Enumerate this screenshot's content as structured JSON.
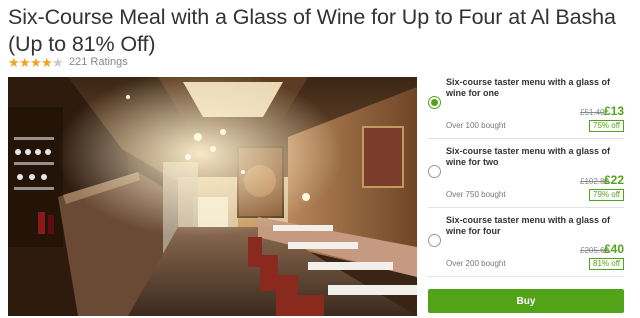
{
  "deal": {
    "title": "Six-Course Meal with a Glass of Wine for Up to Four at Al Basha (Up to 81% Off)",
    "rating_stars": 4,
    "rating_max": 5,
    "ratings_count": "221 Ratings"
  },
  "image": {
    "alt_icon": "restaurant-interior-photo"
  },
  "options": [
    {
      "title": "Six-course taster menu with a glass of wine for one",
      "original_price": "£51.40",
      "price": "£13",
      "bought": "Over 100 bought",
      "discount": "75% off",
      "selected": true
    },
    {
      "title": "Six-course taster menu with a glass of wine for two",
      "original_price": "£102.80",
      "price": "£22",
      "bought": "Over 750 bought",
      "discount": "79% off",
      "selected": false
    },
    {
      "title": "Six-course taster menu with a glass of wine for four",
      "original_price": "£205.60",
      "price": "£40",
      "bought": "Over 200 bought",
      "discount": "81% off",
      "selected": false
    }
  ],
  "buy_label": "Buy",
  "colors": {
    "accent": "#53a318",
    "star": "#f3a31a"
  }
}
